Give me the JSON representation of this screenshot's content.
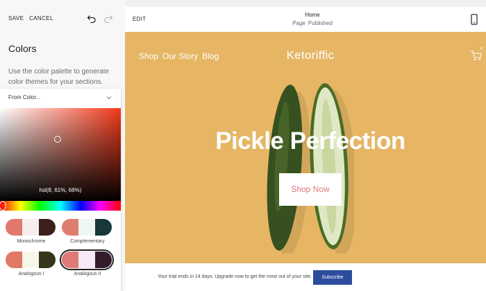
{
  "toolbar": {
    "save_label": "SAVE",
    "cancel_label": "CANCEL",
    "undo_icon": "undo-icon",
    "redo_icon": "redo-icon"
  },
  "colors_panel": {
    "title": "Colors",
    "description": "Use the color palette to generate color themes for your sections.",
    "dropdown": {
      "selected": "From Color..."
    },
    "picker": {
      "hsl_readout": "hsl(8, 61%, 66%)",
      "base_color": "#e0786b"
    },
    "palettes": [
      {
        "label": "Monochrome",
        "colors": [
          "#e0786d",
          "#f6edee",
          "#3b201c"
        ],
        "selected": false
      },
      {
        "label": "Complementary",
        "colors": [
          "#df7d70",
          "#eef6f3",
          "#17373a"
        ],
        "selected": false
      },
      {
        "label": "Analogous I",
        "colors": [
          "#e07868",
          "#f8f6e8",
          "#36361b"
        ],
        "selected": false
      },
      {
        "label": "Analogous II",
        "colors": [
          "#de7b74",
          "#f7e9f5",
          "#331d2b"
        ],
        "selected": true
      }
    ]
  },
  "preview_header": {
    "edit_label": "EDIT",
    "page_title": "Home",
    "page_label": "Page",
    "status": "Published",
    "device_icon": "mobile-icon"
  },
  "site": {
    "nav": [
      "Shop",
      "Our Story",
      "Blog"
    ],
    "logo": "Ketoriffic",
    "cart_count": "0",
    "hero_title": "Pickle Perfection",
    "cta_label": "Shop Now",
    "bg_color": "#e6b665",
    "cta_text_color": "#e0787d"
  },
  "trial_bar": {
    "message": "Your trial ends in 14 days. Upgrade now to get the most out of your site.",
    "subscribe_label": "Subscribe",
    "button_color": "#2c4d9e"
  }
}
